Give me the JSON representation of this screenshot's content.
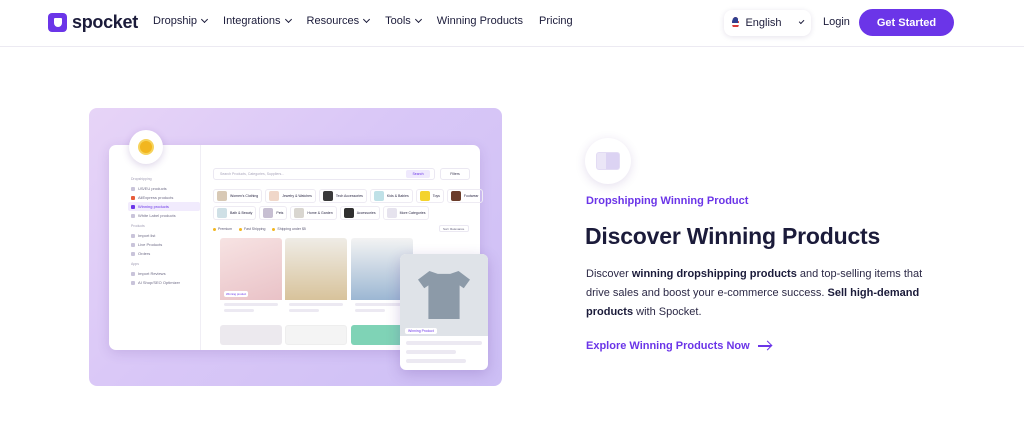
{
  "brand": {
    "name": "spocket",
    "accent": "#6b35e8"
  },
  "nav": {
    "items": [
      {
        "label": "Dropship",
        "has_menu": true
      },
      {
        "label": "Integrations",
        "has_menu": true
      },
      {
        "label": "Resources",
        "has_menu": true
      },
      {
        "label": "Tools",
        "has_menu": true
      },
      {
        "label": "Winning Products",
        "has_menu": false
      },
      {
        "label": "Pricing",
        "has_menu": false
      }
    ],
    "language": "English",
    "login": "Login",
    "cta": "Get Started"
  },
  "hero": {
    "eyebrow": "Dropshipping Winning Product",
    "title": "Discover Winning Products",
    "desc": {
      "p1": "Discover ",
      "b1": "winning dropshipping products",
      "p2": " and top-selling items that drive sales and boost your e-commerce success. ",
      "b2": "Sell high-demand products",
      "p3": " with Spocket."
    },
    "link": "Explore Winning Products Now"
  },
  "mockup": {
    "search_placeholder": "Search Products, Categories, Suppliers...",
    "search_button": "Search",
    "filters": "Filters",
    "sidebar": {
      "section": "Dropshipping",
      "items": [
        "US/EU products",
        "AliExpress products",
        "Winning products",
        "White Label products"
      ],
      "section2": "Products",
      "items2": [
        "Import list",
        "Live Products",
        "Orders"
      ],
      "section3": "Apps",
      "items3": [
        "Import Reviews",
        "AI Shop/SEO Optimizer"
      ]
    },
    "categories_row1": [
      "Women's Clothing",
      "Jewelry & Watches",
      "Tech Accessories",
      "Kids & Babies",
      "Toys",
      "Footwear"
    ],
    "categories_row2": [
      "Bath & Beauty",
      "Pets",
      "Home & Garden",
      "Accessories",
      "More Categories"
    ],
    "filter_chips": [
      "Premium",
      "Fast Shipping",
      "Shipping under $5"
    ],
    "sort": "Sort: Relevance",
    "card_tag": "Winning product",
    "popup_tag": "Winning Product"
  }
}
